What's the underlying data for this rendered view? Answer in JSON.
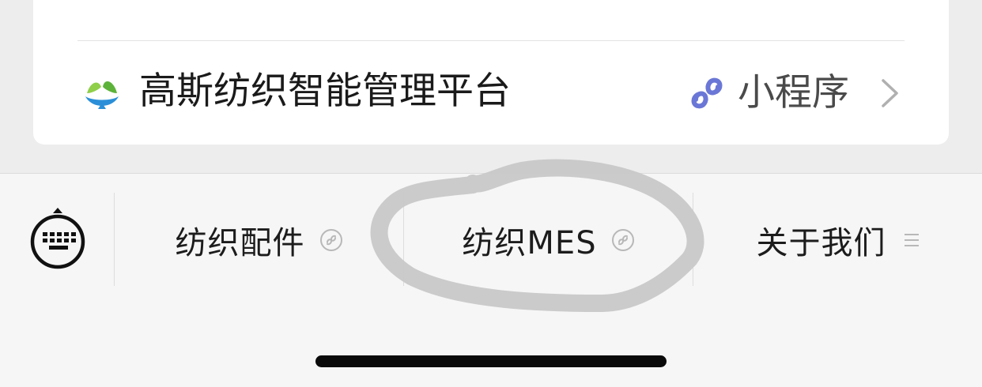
{
  "app_row": {
    "name": "高斯纺织智能管理平台",
    "type_label": "小程序"
  },
  "bottom_menu": {
    "items": [
      {
        "label": "纺织配件",
        "icon": "mini-program-link-icon"
      },
      {
        "label": "纺织MES",
        "icon": "mini-program-link-icon"
      },
      {
        "label": "关于我们",
        "icon": "submenu-list-icon"
      }
    ]
  },
  "colors": {
    "mini_program_accent": "#6b77d6",
    "logo_green": "#6cbf3c",
    "logo_blue": "#2a8fd8",
    "scribble_gray": "#c8c8c8"
  }
}
